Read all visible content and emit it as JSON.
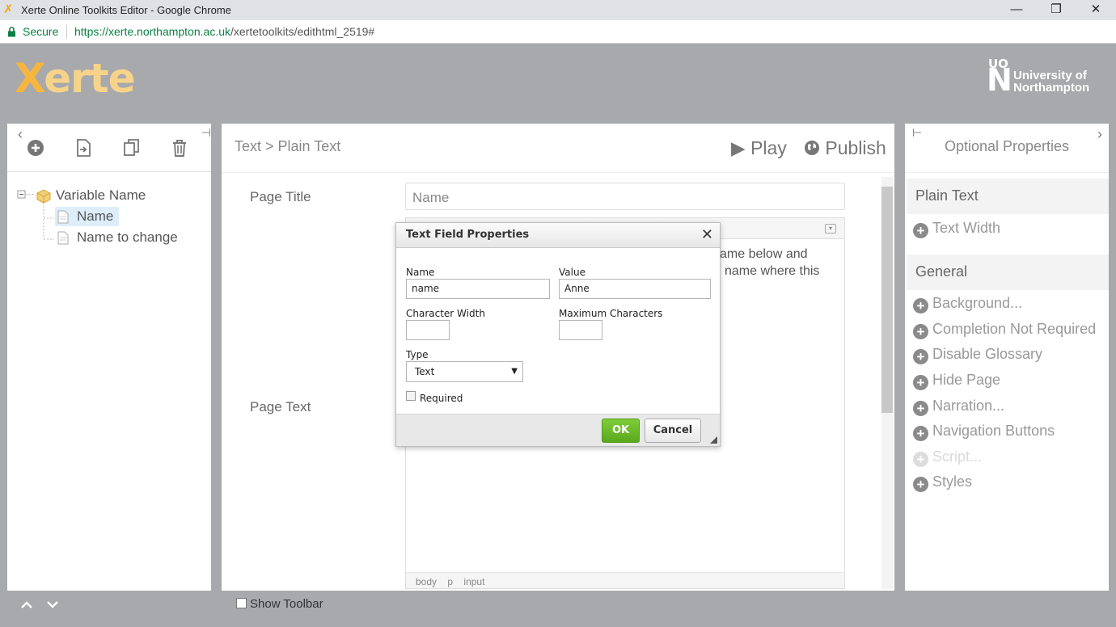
{
  "browser": {
    "window_title": "Xerte Online Toolkits Editor - Google Chrome",
    "secure_label": "Secure",
    "url_host": "https://xerte.northampton.ac.uk",
    "url_path": "/xertetoolkits/edithtml_2519#",
    "controls": {
      "minimize": "—",
      "restore": "❐",
      "close": "✕"
    }
  },
  "header": {
    "logo_x": "X",
    "logo_rest": "erte",
    "university_mark_top": "UO",
    "university_mark_letter": "N",
    "university_name_line1": "University of",
    "university_name_line2": "Northampton"
  },
  "left_panel": {
    "tree": {
      "root": "Variable Name",
      "children": [
        "Name",
        "Name to change"
      ],
      "selected": "Name"
    }
  },
  "center": {
    "breadcrumb": "Text > Plain Text",
    "play_label": "Play",
    "publish_label": "Publish",
    "page_title_label": "Page Title",
    "page_title_value": "Name",
    "page_text_label": "Page Text",
    "editor_text_line1": "ame below and",
    "editor_text_line2": "name where this",
    "status_path": [
      "body",
      "p",
      "input"
    ],
    "show_toolbar_label": "Show Toolbar"
  },
  "right_panel": {
    "title": "Optional Properties",
    "sections": [
      {
        "title": "Plain Text",
        "items": [
          {
            "label": "Text Width",
            "enabled": true
          }
        ]
      },
      {
        "title": "General",
        "items": [
          {
            "label": "Background...",
            "enabled": true
          },
          {
            "label": "Completion Not Required",
            "enabled": true
          },
          {
            "label": "Disable Glossary",
            "enabled": true
          },
          {
            "label": "Hide Page",
            "enabled": true
          },
          {
            "label": "Narration...",
            "enabled": true
          },
          {
            "label": "Navigation Buttons",
            "enabled": true
          },
          {
            "label": "Script...",
            "enabled": false
          },
          {
            "label": "Styles",
            "enabled": true
          }
        ]
      }
    ]
  },
  "dialog": {
    "title": "Text Field Properties",
    "name_label": "Name",
    "name_value": "name",
    "value_label": "Value",
    "value_value": "Anne",
    "char_width_label": "Character Width",
    "char_width_value": "",
    "max_chars_label": "Maximum Characters",
    "max_chars_value": "",
    "type_label": "Type",
    "type_selected": "Text",
    "required_label": "Required",
    "ok_label": "OK",
    "cancel_label": "Cancel"
  }
}
